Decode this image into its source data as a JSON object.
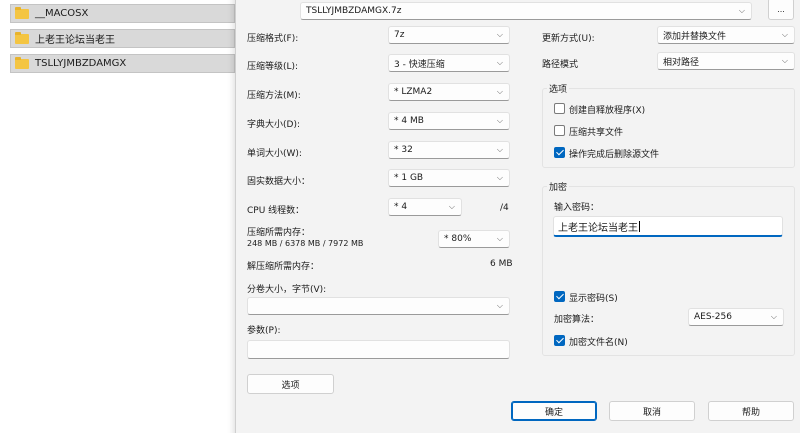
{
  "file_list": {
    "items": [
      "__MACOSX",
      "上老王论坛当老王",
      "TSLLYJMBZDAMGX"
    ]
  },
  "archive": {
    "name": "TSLLYJMBZDAMGX.7z",
    "browse_label": "..."
  },
  "left": {
    "format_label": "压缩格式(F):",
    "format_value": "7z",
    "level_label": "压缩等级(L):",
    "level_value": "3 - 快速压缩",
    "method_label": "压缩方法(M):",
    "method_value": "* LZMA2",
    "dict_label": "字典大小(D):",
    "dict_value": "* 4 MB",
    "word_label": "单词大小(W):",
    "word_value": "* 32",
    "solid_label": "固实数据大小：",
    "solid_value": "* 1 GB",
    "cpu_label": "CPU 线程数：",
    "cpu_value": "* 4",
    "cpu_total": "/4",
    "mem_label": "压缩所需内存：",
    "mem_detail": "248 MB / 6378 MB / 7972 MB",
    "mem_value": "* 80%",
    "decomp_label": "解压缩所需内存：",
    "decomp_value": "6 MB",
    "split_label": "分卷大小，字节(V):",
    "split_value": "",
    "params_label": "参数(P):",
    "params_value": "",
    "options_button": "选项"
  },
  "right": {
    "update_label": "更新方式(U):",
    "update_value": "添加并替换文件",
    "path_label": "路径模式",
    "path_value": "相对路径",
    "options_title": "选项",
    "sfx_label": "创建自释放程序(X)",
    "sfx_checked": false,
    "shared_label": "压缩共享文件",
    "shared_checked": false,
    "delete_label": "操作完成后删除源文件",
    "delete_checked": true,
    "encrypt_title": "加密",
    "password_label": "输入密码：",
    "password_value": "上老王论坛当老王",
    "show_pwd_label": "显示密码(S)",
    "show_pwd_checked": true,
    "algo_label": "加密算法：",
    "algo_value": "AES-256",
    "encrypt_names_label": "加密文件名(N)",
    "encrypt_names_checked": true
  },
  "buttons": {
    "ok": "确定",
    "cancel": "取消",
    "help": "帮助"
  },
  "colors": {
    "accent": "#0067c0",
    "folder": "#f4c542"
  }
}
